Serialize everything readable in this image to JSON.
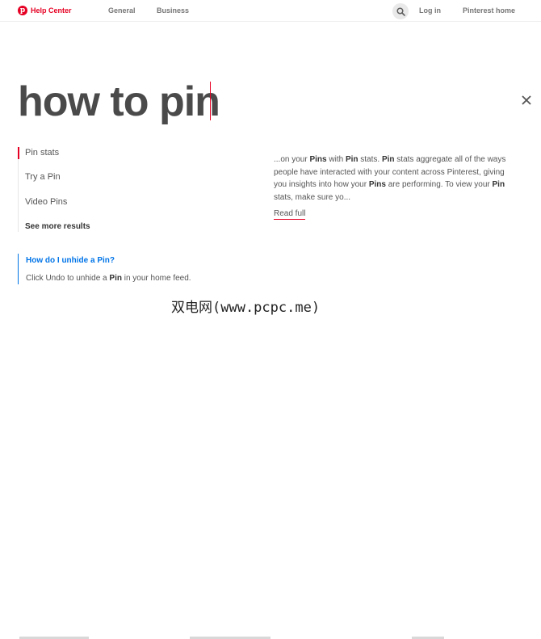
{
  "header": {
    "brand": "Help Center",
    "nav": [
      "General",
      "Business"
    ],
    "login": "Log in",
    "home_link": "Pinterest home"
  },
  "search": {
    "query": "how to pin"
  },
  "suggestions": {
    "items": [
      "Pin stats",
      "Try a Pin",
      "Video Pins"
    ],
    "see_more": "See more results"
  },
  "result": {
    "snippet_parts": [
      "...on your ",
      "Pins",
      " with ",
      "Pin",
      " stats. ",
      "Pin",
      " stats aggregate all of the ways people have interacted with your content across Pinterest, giving you insights into how your ",
      "Pins",
      " are performing. To view your ",
      "Pin",
      " stats, make sure yo..."
    ],
    "read_full": "Read full"
  },
  "faq": {
    "title": "How do I unhide a Pin?",
    "body_parts": [
      "Click Undo to unhide a ",
      "Pin",
      " in your home feed."
    ]
  },
  "watermark": "双电网(www.pcpc.me)",
  "colors": {
    "brand": "#e60023",
    "link_blue": "#0074e8",
    "query_text": "#4a4a4a"
  },
  "icons": {
    "logo": "pinterest-logo-icon",
    "search": "search-icon",
    "close": "close-icon"
  }
}
